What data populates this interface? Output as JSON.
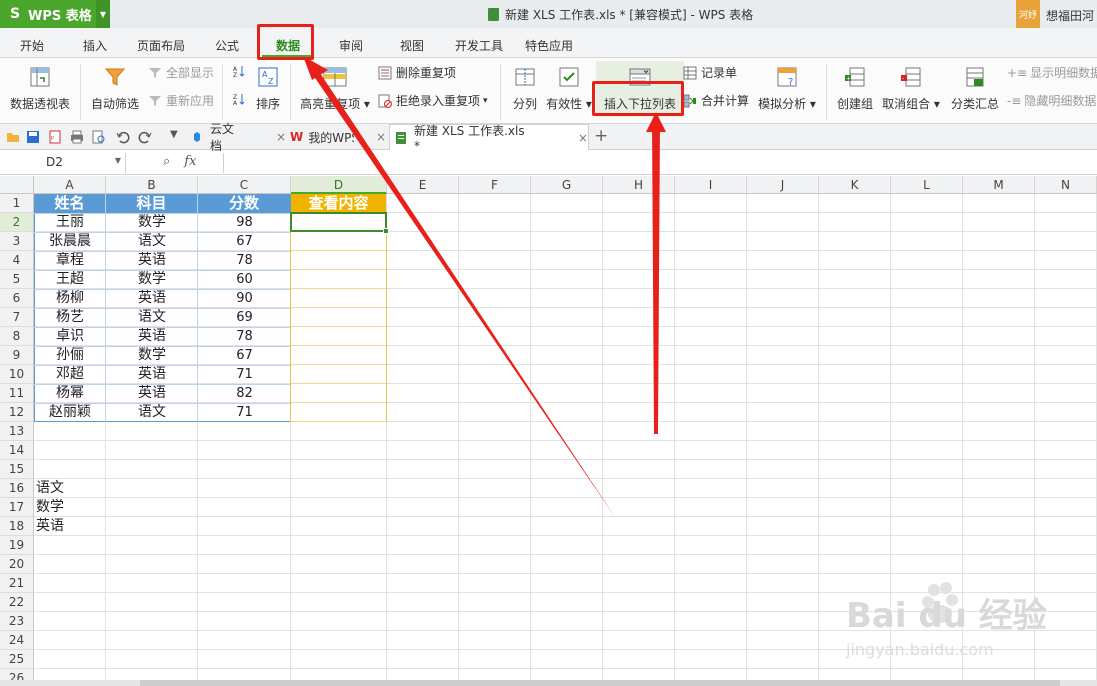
{
  "app": {
    "menu_label": "WPS 表格",
    "doc_title": "新建 XLS 工作表.xls * [兼容模式] - WPS 表格",
    "user_chip": "河妤",
    "user_name": "想福田河"
  },
  "ribbon_tabs": [
    "开始",
    "插入",
    "页面布局",
    "公式",
    "数据",
    "审阅",
    "视图",
    "开发工具",
    "特色应用"
  ],
  "ribbon_active_tab": "数据",
  "ribbon": {
    "pivot": "数据透视表",
    "autofilter": "自动筛选",
    "show_all": "全部显示",
    "reapply": "重新应用",
    "sort": "排序",
    "highlight_dup": "高亮重复项",
    "remove_dup": "删除重复项",
    "reject_dup": "拒绝录入重复项",
    "split": "分列",
    "validity": "有效性",
    "insert_dropdown": "插入下拉列表",
    "record_form": "记录单",
    "consolidate": "合并计算",
    "what_if": "模拟分析",
    "group": "创建组",
    "ungroup": "取消组合",
    "subtotal": "分类汇总",
    "show_detail": "显示明细数据",
    "hide_detail": "隐藏明细数据"
  },
  "doc_tabs": [
    {
      "label": "云文档",
      "icon": "cloud-icon"
    },
    {
      "label": "我的WPS",
      "icon": "wps-icon"
    },
    {
      "label": "新建 XLS 工作表.xls *",
      "icon": "sheet-icon"
    }
  ],
  "formula_bar": {
    "name_box": "D2",
    "fx_label": "fx",
    "formula": ""
  },
  "sheet": {
    "columns": [
      "A",
      "B",
      "C",
      "D",
      "E",
      "F",
      "G",
      "H",
      "I",
      "J",
      "K",
      "L",
      "M",
      "N"
    ],
    "rows": [
      "1",
      "2",
      "3",
      "4",
      "5",
      "6",
      "7",
      "8",
      "9",
      "10",
      "11",
      "12",
      "13",
      "14",
      "15",
      "16",
      "17",
      "18",
      "19",
      "20",
      "21",
      "22",
      "23",
      "24",
      "25",
      "26"
    ],
    "selected_cell": "D2",
    "header": [
      "姓名",
      "科目",
      "分数",
      "查看内容"
    ],
    "data": [
      [
        "王丽",
        "数学",
        "98"
      ],
      [
        "张晨晨",
        "语文",
        "67"
      ],
      [
        "章程",
        "英语",
        "78"
      ],
      [
        "王超",
        "数学",
        "60"
      ],
      [
        "杨柳",
        "英语",
        "90"
      ],
      [
        "杨艺",
        "语文",
        "69"
      ],
      [
        "卓识",
        "英语",
        "78"
      ],
      [
        "孙俪",
        "数学",
        "67"
      ],
      [
        "邓超",
        "英语",
        "71"
      ],
      [
        "杨幂",
        "英语",
        "82"
      ],
      [
        "赵丽颖",
        "语文",
        "71"
      ]
    ],
    "source_list": [
      "语文",
      "数学",
      "英语"
    ],
    "colors": {
      "header_blue": "#5b9bd5",
      "header_gold": "#f0b400",
      "selection_green": "#3c8a2a"
    }
  },
  "watermark": {
    "logo": "Bai du 经验",
    "url": "jingyan.baidu.com"
  },
  "annotation_color": "#e8201a"
}
